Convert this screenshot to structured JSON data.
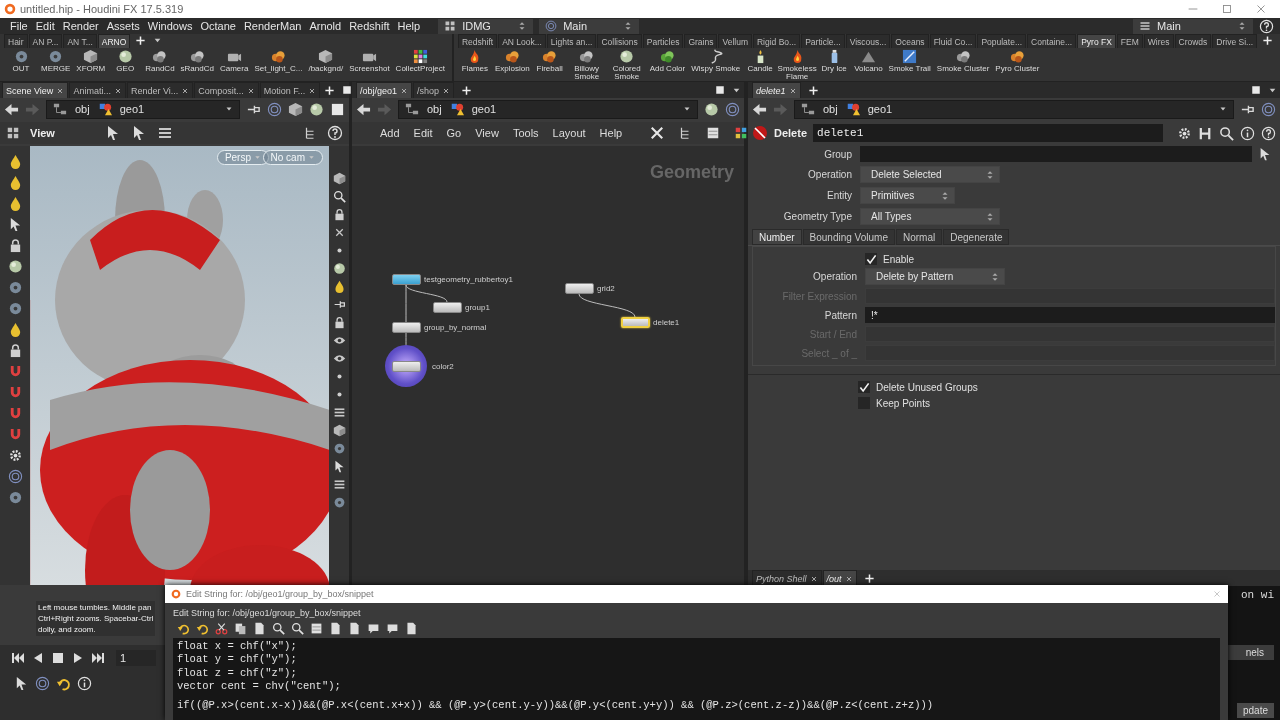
{
  "window": {
    "title": "untitled.hip - Houdini FX 17.5.319"
  },
  "menu_bar": {
    "items": [
      "File",
      "Edit",
      "Render",
      "Assets",
      "Windows",
      "Octane",
      "RenderMan",
      "Arnold",
      "Redshift",
      "Help"
    ],
    "desktop": "IDMG",
    "layout": "Main",
    "right_desktop": "Main"
  },
  "shelf_left": {
    "tabs": [
      {
        "label": "Hair",
        "selected": false
      },
      {
        "label": "AN P...",
        "selected": false
      },
      {
        "label": "AN T...",
        "selected": false
      },
      {
        "label": "ARNO",
        "selected": true
      }
    ],
    "tools": [
      "OUT",
      "MERGE",
      "XFORM",
      "GEO",
      "RandCd",
      "sRandCd",
      "Camera",
      "Set_light_C...",
      "/backgnd/",
      "Screenshot",
      "CollectProject"
    ]
  },
  "shelf_right": {
    "tabs": [
      {
        "label": "Redshift",
        "selected": false
      },
      {
        "label": "AN Look...",
        "selected": false
      },
      {
        "label": "Lights an...",
        "selected": false
      },
      {
        "label": "Collisions",
        "selected": false
      },
      {
        "label": "Particles",
        "selected": false
      },
      {
        "label": "Grains",
        "selected": false
      },
      {
        "label": "Vellum",
        "selected": false
      },
      {
        "label": "Rigid Bo...",
        "selected": false
      },
      {
        "label": "Particle...",
        "selected": false
      },
      {
        "label": "Viscous...",
        "selected": false
      },
      {
        "label": "Oceans",
        "selected": false
      },
      {
        "label": "Fluid Co...",
        "selected": false
      },
      {
        "label": "Populate...",
        "selected": false
      },
      {
        "label": "Containe...",
        "selected": false
      },
      {
        "label": "Pyro FX",
        "selected": true
      },
      {
        "label": "FEM",
        "selected": false
      },
      {
        "label": "Wires",
        "selected": false
      },
      {
        "label": "Crowds",
        "selected": false
      },
      {
        "label": "Drive Si...",
        "selected": false
      }
    ],
    "tools": [
      "Flames",
      "Explosion",
      "Fireball",
      "Billowy Smoke",
      "Colored Smoke",
      "Add Color",
      "Wispy Smoke",
      "Candle",
      "Smokeless Flame",
      "Dry Ice",
      "Volcano",
      "Smoke Trail",
      "Smoke Cluster",
      "Pyro Cluster"
    ]
  },
  "scene_view": {
    "tabs": [
      {
        "label": "Scene View",
        "selected": true
      },
      {
        "label": "Animati...",
        "selected": false
      },
      {
        "label": "Render Vi...",
        "selected": false
      },
      {
        "label": "Composit...",
        "selected": false
      },
      {
        "label": "Motion F...",
        "selected": false
      }
    ],
    "path": [
      "obj",
      "geo1"
    ],
    "toolbar_label": "View",
    "camera_menus": [
      "Persp",
      "No cam"
    ],
    "help_text": "Left mouse tumbles. Middle pan\nCtrl+Right zooms. Spacebar-Ctrl\ndolly, and zoom.",
    "frame": "1"
  },
  "network_view": {
    "tabs": [
      {
        "label": "/obj/geo1",
        "selected": true
      },
      {
        "label": "/shop",
        "selected": false
      }
    ],
    "path": [
      "obj",
      "geo1"
    ],
    "menu": [
      "Add",
      "Edit",
      "Go",
      "View",
      "Tools",
      "Layout",
      "Help"
    ],
    "context": "Geometry",
    "nodes": [
      {
        "name": "testgeometry_rubbertoy1",
        "kind": "source",
        "selected": false,
        "display": false
      },
      {
        "name": "group1",
        "kind": "sop",
        "selected": false,
        "display": false
      },
      {
        "name": "group_by_normal",
        "kind": "sop",
        "selected": false,
        "display": false
      },
      {
        "name": "color2",
        "kind": "sop",
        "selected": false,
        "display": true
      },
      {
        "name": "grid2",
        "kind": "sop",
        "selected": false,
        "display": false
      },
      {
        "name": "delete1",
        "kind": "sop",
        "selected": true,
        "display": false
      }
    ]
  },
  "parameters": {
    "tabs": [
      {
        "label": "delete1",
        "selected": true
      }
    ],
    "path": [
      "obj",
      "geo1"
    ],
    "node_type": "Delete",
    "node_name": "delete1",
    "fields": [
      {
        "kind": "text",
        "label": "Group",
        "disabled": false
      },
      {
        "kind": "menu",
        "label": "Operation",
        "value": "Delete Selected",
        "disabled": false
      },
      {
        "kind": "menu",
        "label": "Entity",
        "value": "Primitives",
        "disabled": false
      },
      {
        "kind": "menu",
        "label": "Geometry Type",
        "value": "All Types",
        "disabled": false
      }
    ],
    "folder_tabs": [
      {
        "label": "Number",
        "selected": true
      },
      {
        "label": "Bounding Volume",
        "selected": false
      },
      {
        "label": "Normal",
        "selected": false
      },
      {
        "label": "Degenerate",
        "selected": false
      }
    ],
    "folder_fields": [
      {
        "kind": "checkbox",
        "label": "Enable",
        "checked": true
      },
      {
        "kind": "menu",
        "label": "Operation",
        "value": "Delete by Pattern",
        "disabled": false
      },
      {
        "kind": "text",
        "label": "Filter Expression",
        "disabled": true
      },
      {
        "kind": "text",
        "label": "Pattern",
        "value": "!*",
        "disabled": false
      },
      {
        "kind": "text",
        "label": "Start / End",
        "disabled": true
      },
      {
        "kind": "text",
        "label": "Select _ of _",
        "disabled": true
      }
    ],
    "options": [
      {
        "label": "Delete Unused Groups",
        "checked": true
      },
      {
        "label": "Keep Points",
        "checked": false
      }
    ]
  },
  "shell": {
    "tabs": [
      {
        "label": "Python Shell",
        "selected": false
      },
      {
        "label": "/out",
        "selected": true
      }
    ],
    "output": "on wi",
    "menu_fragment": "nels",
    "button_fragment": "pdate"
  },
  "edit_dialog": {
    "title": "Edit String for: /obj/geo1/group_by_box/snippet",
    "heading": "Edit String for: /obj/geo1/group_by_box/snippet",
    "code": [
      "float x = chf(\"x\");",
      "float y = chf(\"y\");",
      "float z = chf(\"z\");",
      "vector cent = chv(\"cent\");",
      "if((@P.x>(cent.x-x))&&(@P.x<(cent.x+x)) && (@P.y>(cent.y-y))&&(@P.y<(cent.y+y)) && (@P.z>(cent.z-z))&&(@P.z<(cent.z+z)))"
    ]
  }
}
